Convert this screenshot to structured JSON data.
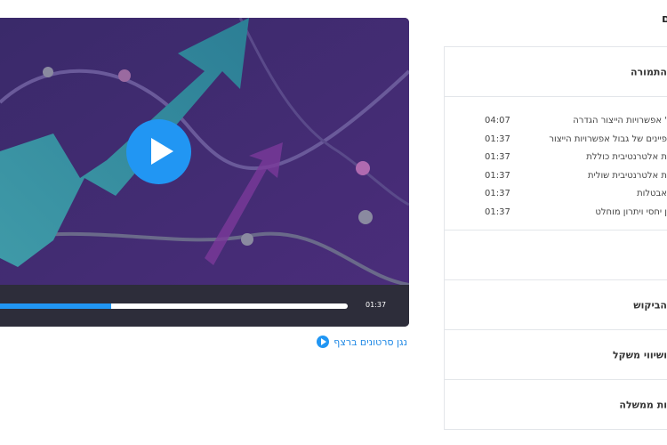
{
  "player": {
    "current_time": "01:37",
    "progress": 0.32
  },
  "autoplay": {
    "label": "נגן סרטונים ברצף"
  },
  "header": {
    "title": "ם"
  },
  "course": {
    "open_section": {
      "title": "התמורה",
      "lessons": [
        {
          "title": "' אפשרויות הייצור הגדרה",
          "duration": "04:07"
        },
        {
          "title": "פיינים של גבול אפשרויות הייצור",
          "duration": "01:37"
        },
        {
          "title": "ת אלטרנטיבית כוללת",
          "duration": "01:37"
        },
        {
          "title": "ת אלטרנטיבית שולית",
          "duration": "01:37"
        },
        {
          "title": "אבטלות",
          "duration": "01:37"
        },
        {
          "title": "ן יחסי ויתרון מוחלט",
          "duration": "01:37"
        }
      ]
    },
    "sections": [
      {
        "title": "הביקוש"
      },
      {
        "title": "ושיווי משקל"
      },
      {
        "title": "ות ממשלה"
      }
    ]
  }
}
